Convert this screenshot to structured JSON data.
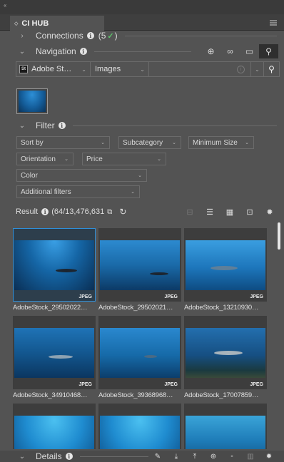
{
  "panel": {
    "tab_title": "CI HUB"
  },
  "connections": {
    "label": "Connections",
    "count": "(5",
    "close_paren": ")"
  },
  "navigation": {
    "label": "Navigation"
  },
  "search": {
    "provider": "Adobe St…",
    "provider_badge": "St",
    "type": "Images",
    "placeholder": ""
  },
  "filter": {
    "label": "Filter",
    "sort_by": "Sort by",
    "subcategory": "Subcategory",
    "minimum_size": "Minimum Size",
    "orientation": "Orientation",
    "price": "Price",
    "color": "Color",
    "additional_filters": "Additional filters"
  },
  "result": {
    "label": "Result",
    "count": "(64/13,476,631"
  },
  "items": [
    {
      "name": "AdobeStock_29502022…",
      "badge": "JPEG"
    },
    {
      "name": "AdobeStock_29502021…",
      "badge": "JPEG"
    },
    {
      "name": "AdobeStock_13210930…",
      "badge": "JPEG"
    },
    {
      "name": "AdobeStock_34910468…",
      "badge": "JPEG"
    },
    {
      "name": "AdobeStock_39368968…",
      "badge": "JPEG"
    },
    {
      "name": "AdobeStock_17007859…",
      "badge": "JPEG"
    },
    {
      "name": "",
      "badge": ""
    },
    {
      "name": "",
      "badge": ""
    },
    {
      "name": "",
      "badge": ""
    }
  ],
  "details": {
    "label": "Details"
  },
  "colors": {
    "panel_bg": "#535353",
    "selection": "#2f8fd8",
    "check": "#5cc36a"
  }
}
